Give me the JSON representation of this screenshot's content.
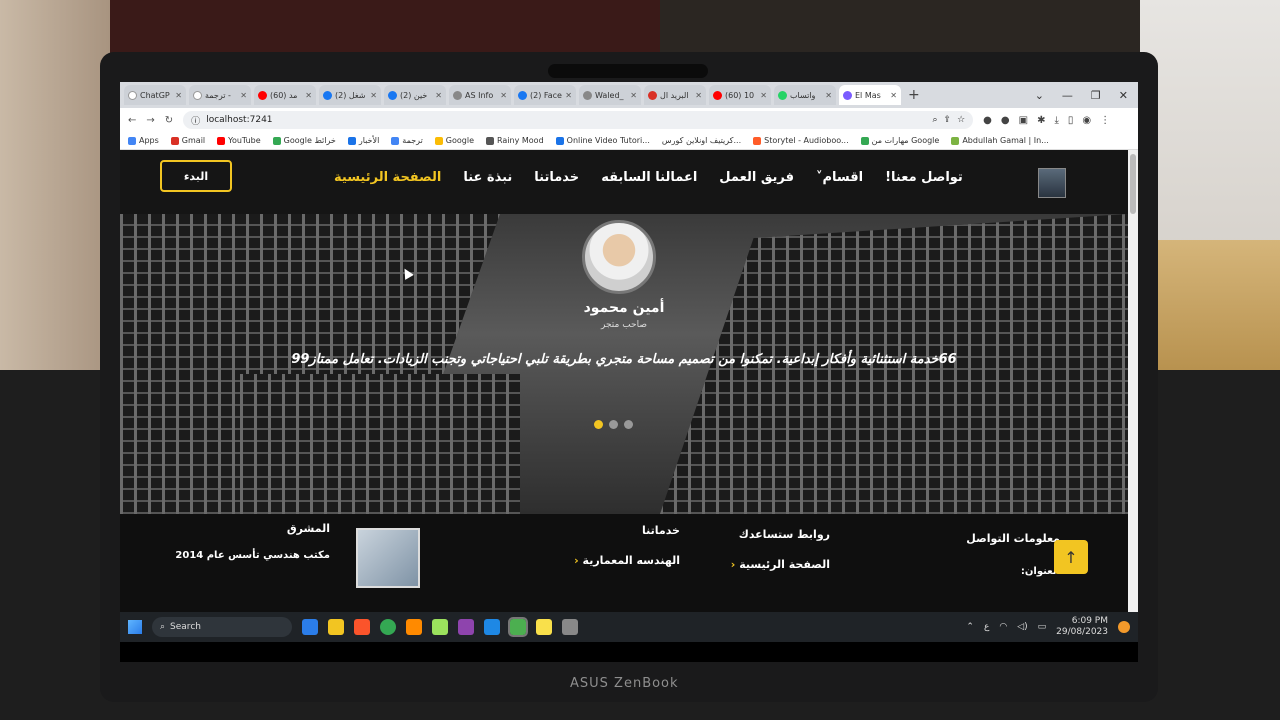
{
  "browser": {
    "tabs": [
      {
        "label": "ChatGP",
        "color": "#ffffff"
      },
      {
        "label": "ترجمة -",
        "color": "#ffffff"
      },
      {
        "label": "(60) مد",
        "color": "#ff0000"
      },
      {
        "label": "(2) شغل",
        "color": "#1877f2"
      },
      {
        "label": "(2) خين",
        "color": "#1877f2"
      },
      {
        "label": "AS Info",
        "color": "#888888"
      },
      {
        "label": "(2) Face",
        "color": "#1877f2"
      },
      {
        "label": "Waled_",
        "color": "#888888"
      },
      {
        "label": "البريد ال",
        "color": "#d93025"
      },
      {
        "label": "(60) 10",
        "color": "#ff0000"
      },
      {
        "label": "واتساب",
        "color": "#25d366"
      },
      {
        "label": "El Mas",
        "color": "#7a5cff"
      }
    ],
    "url": "localhost:7241",
    "bookmarks": [
      "Apps",
      "Gmail",
      "YouTube",
      "Google خرائط",
      "الأخبار",
      "ترجمة",
      "Google",
      "Rainy Mood",
      "Online Video Tutori...",
      "كريتيف اونلاين كورس...",
      "Storytel - Audioboo...",
      "مهارات من Google",
      "Abdullah Gamal | In..."
    ]
  },
  "site": {
    "cta_label": "البدء",
    "menu": [
      "الصفحة الرئيسية",
      "نبذة عنا",
      "خدماتنا",
      "اعمالنا السابقه",
      "فريق العمل",
      "اقسام˅",
      "تواصل معنا!"
    ],
    "testimonial": {
      "name": "أمين محمود",
      "role": "صاحب متجر",
      "quote": "66خدمة استثنائية وأفكار إبداعية. تمكنوا من تصميم مساحة متجري بطريقة تلبي احتياجاتي وتجنب الزيادات. تعامل ممتاز99"
    },
    "footer": {
      "contact_title": "معلومات التواصل",
      "address_label": "العنوان:",
      "links_title": "روابط ستساعدك",
      "link_home": "الصفحة الرئيسية",
      "services_title": "خدماتنا",
      "service_1": "الهندسه المعمارية",
      "project_title": "المشرق",
      "project_desc": "مكتب هندسي تأسس عام 2014"
    }
  },
  "taskbar": {
    "search_placeholder": "Search",
    "time": "6:09 PM",
    "date": "29/08/2023",
    "lang": "ع"
  },
  "device": {
    "brand": "ASUS ZenBook"
  }
}
